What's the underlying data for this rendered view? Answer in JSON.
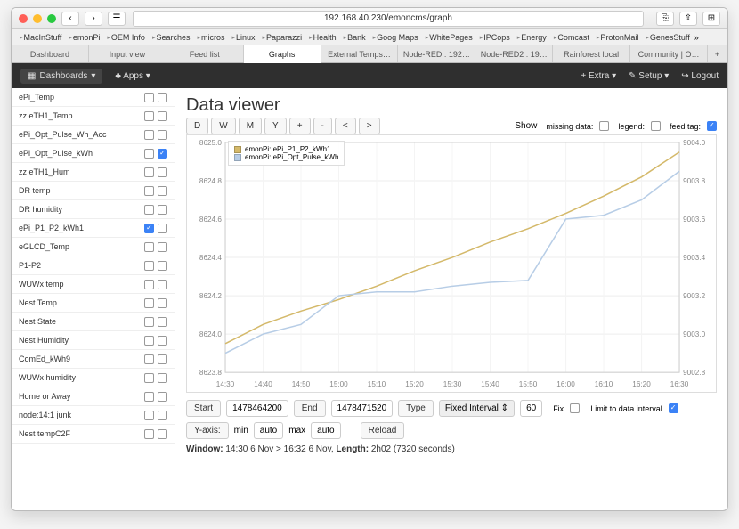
{
  "browser": {
    "url": "192.168.40.230/emoncms/graph",
    "bookmarks": [
      "MacInStuff",
      "emonPi",
      "OEM Info",
      "Searches",
      "micros",
      "Linux",
      "Paparazzi",
      "Health",
      "Bank",
      "Goog Maps",
      "WhitePages",
      "IPCops",
      "Energy",
      "Comcast",
      "ProtonMail",
      "GenesStuff"
    ],
    "tabs": [
      "Dashboard",
      "Input view",
      "Feed list",
      "Graphs",
      "External Temps…",
      "Node-RED : 192…",
      "Node-RED2 : 19…",
      "Rainforest local",
      "Community | O…"
    ],
    "active_tab": 3
  },
  "appbar": {
    "dashboards": "Dashboards",
    "apps": "Apps",
    "extra": "Extra",
    "setup": "Setup",
    "logout": "Logout"
  },
  "feeds": [
    {
      "name": "ePi_Temp",
      "c1": false,
      "c2": false
    },
    {
      "name": "zz eTH1_Temp",
      "c1": false,
      "c2": false
    },
    {
      "name": "ePi_Opt_Pulse_Wh_Acc",
      "c1": false,
      "c2": false
    },
    {
      "name": "ePi_Opt_Pulse_kWh",
      "c1": false,
      "c2": true
    },
    {
      "name": "zz eTH1_Hum",
      "c1": false,
      "c2": false
    },
    {
      "name": "DR temp",
      "c1": false,
      "c2": false
    },
    {
      "name": "DR humidity",
      "c1": false,
      "c2": false
    },
    {
      "name": "ePi_P1_P2_kWh1",
      "c1": true,
      "c2": false
    },
    {
      "name": "eGLCD_Temp",
      "c1": false,
      "c2": false
    },
    {
      "name": "P1-P2",
      "c1": false,
      "c2": false
    },
    {
      "name": "WUWx temp",
      "c1": false,
      "c2": false
    },
    {
      "name": "Nest Temp",
      "c1": false,
      "c2": false
    },
    {
      "name": "Nest State",
      "c1": false,
      "c2": false
    },
    {
      "name": "Nest Humidity",
      "c1": false,
      "c2": false
    },
    {
      "name": "ComEd_kWh9",
      "c1": false,
      "c2": false
    },
    {
      "name": "WUWx humidity",
      "c1": false,
      "c2": false
    },
    {
      "name": "Home or Away",
      "c1": false,
      "c2": false
    },
    {
      "name": "node:14:1 junk",
      "c1": false,
      "c2": false
    },
    {
      "name": "Nest tempC2F",
      "c1": false,
      "c2": false
    }
  ],
  "viewer": {
    "title": "Data viewer",
    "range_btns": [
      "D",
      "W",
      "M",
      "Y",
      "+",
      "-",
      "<",
      ">"
    ],
    "show_label": "Show",
    "opts": {
      "missing": "missing data:",
      "legend": "legend:",
      "feedtag": "feed tag:"
    },
    "opts_state": {
      "missing": false,
      "legend": false,
      "feedtag": true
    }
  },
  "form": {
    "start_lbl": "Start",
    "start": "1478464200",
    "end_lbl": "End",
    "end": "1478471520",
    "type_lbl": "Type",
    "type": "Fixed Interval",
    "type_val": "60",
    "fix_lbl": "Fix",
    "fix": false,
    "limit_lbl": "Limit to data interval",
    "limit": true,
    "yaxis_lbl": "Y-axis:",
    "min_lbl": "min",
    "min": "auto",
    "max_lbl": "max",
    "max": "auto",
    "reload": "Reload",
    "window_line": "14:30 6 Nov > 16:32 6 Nov,",
    "window_lbl": "Window:",
    "length_lbl": "Length:",
    "length": "2h02 (7320 seconds)"
  },
  "chart_data": {
    "type": "line",
    "x_ticks": [
      "14:30",
      "14:40",
      "14:50",
      "15:00",
      "15:10",
      "15:20",
      "15:30",
      "15:40",
      "15:50",
      "16:00",
      "16:10",
      "16:20",
      "16:30"
    ],
    "series": [
      {
        "name": "emonPi: ePi_P1_P2_kWh1",
        "axis": "left",
        "color": "#d4b96a",
        "values": [
          8623.95,
          8624.05,
          8624.12,
          8624.18,
          8624.25,
          8624.33,
          8624.4,
          8624.48,
          8624.55,
          8624.63,
          8624.72,
          8624.82,
          8624.95
        ]
      },
      {
        "name": "emonPi: ePi_Opt_Pulse_kWh",
        "axis": "right",
        "color": "#b7cde6",
        "values": [
          9002.9,
          9003.0,
          9003.05,
          9003.2,
          9003.22,
          9003.22,
          9003.25,
          9003.27,
          9003.28,
          9003.6,
          9003.62,
          9003.7,
          9003.85
        ]
      }
    ],
    "left_axis": {
      "min": 8623.8,
      "max": 8625.0,
      "ticks": [
        8623.8,
        8624.0,
        8624.2,
        8624.4,
        8624.6,
        8624.8,
        8625.0
      ]
    },
    "right_axis": {
      "min": 9002.8,
      "max": 9004.0,
      "ticks": [
        9002.8,
        9003.0,
        9003.2,
        9003.4,
        9003.6,
        9003.8,
        9004.0
      ]
    }
  }
}
